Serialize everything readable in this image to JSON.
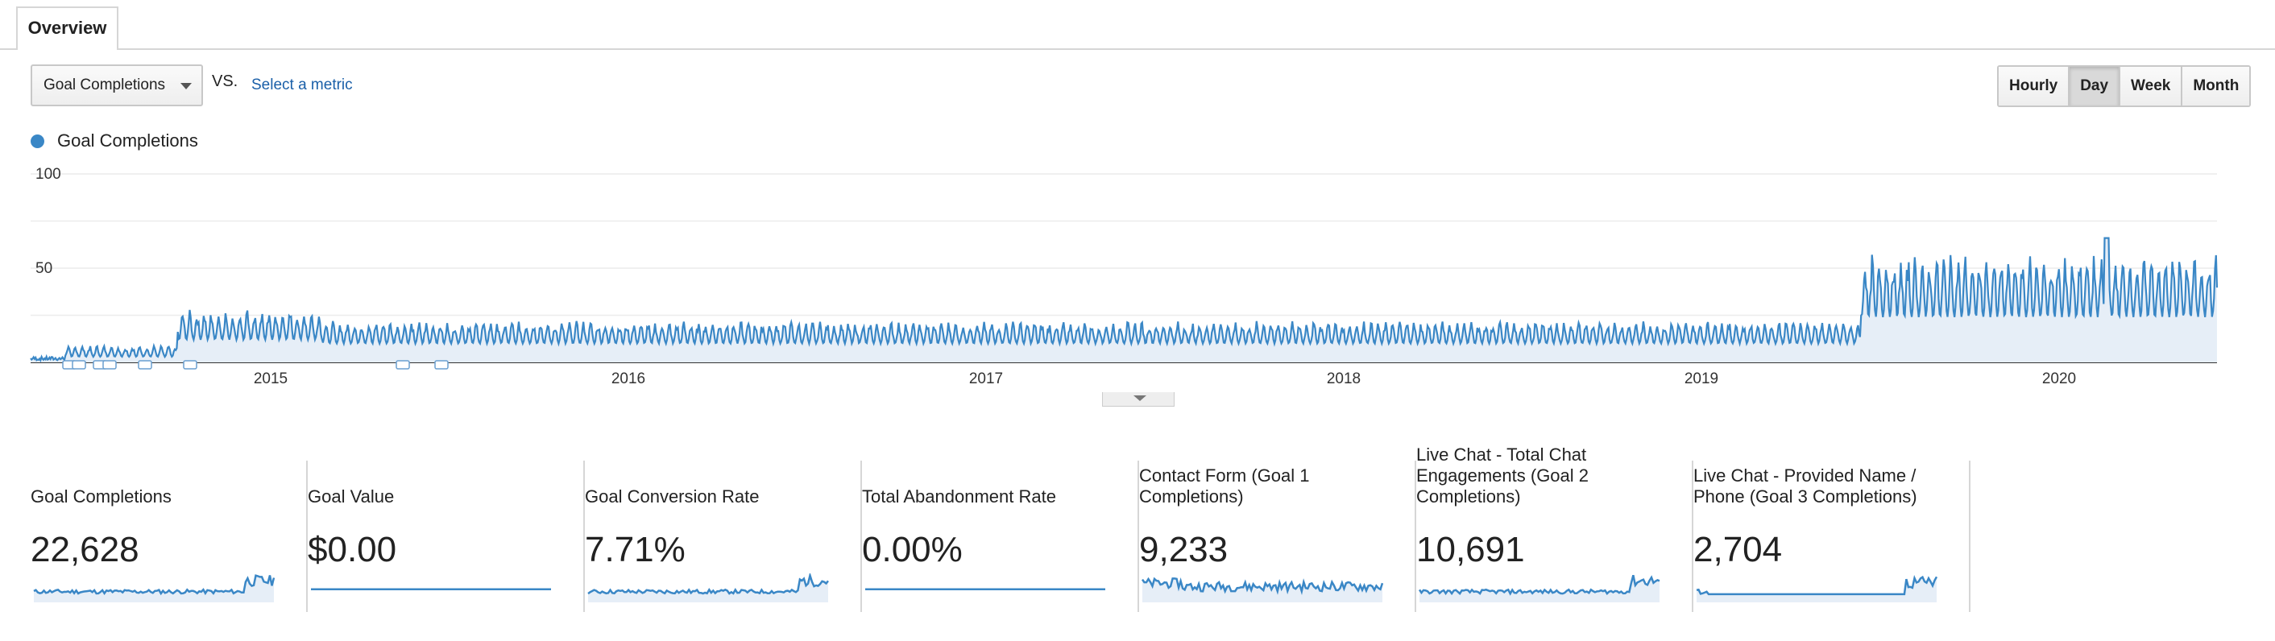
{
  "tabs": {
    "overview": "Overview"
  },
  "metric_selector": {
    "value": "Goal Completions",
    "vs": "VS.",
    "select_metric": "Select a metric"
  },
  "periods": [
    {
      "label": "Hourly",
      "active": false
    },
    {
      "label": "Day",
      "active": true
    },
    {
      "label": "Week",
      "active": false
    },
    {
      "label": "Month",
      "active": false
    }
  ],
  "legend": {
    "series": "Goal Completions",
    "color": "#3a87c6"
  },
  "chart_data": {
    "type": "area",
    "series": [
      {
        "name": "Goal Completions"
      }
    ],
    "y_ticks": [
      "100",
      "50"
    ],
    "ylim": [
      0,
      100
    ],
    "x_labels": [
      "2015",
      "2016",
      "2017",
      "2018",
      "2019",
      "2020"
    ],
    "segments": [
      {
        "start": "2014-06",
        "end": "2014-12",
        "base": 5,
        "amp": 7
      },
      {
        "start": "2015-01",
        "end": "2015-06",
        "base": 14,
        "amp": 16
      },
      {
        "start": "2015-06",
        "end": "2019-06",
        "base": 12,
        "amp": 12
      },
      {
        "start": "2019-06",
        "end": "2020-05",
        "base": 30,
        "amp": 30
      }
    ],
    "peak": {
      "date": "2020-02",
      "value": 66
    },
    "grid": true
  },
  "cards": [
    {
      "label": "Goal Completions",
      "value": "22,628",
      "spark": "step"
    },
    {
      "label": "Goal Value",
      "value": "$0.00",
      "spark": "flat"
    },
    {
      "label": "Goal Conversion Rate",
      "value": "7.71%",
      "spark": "step"
    },
    {
      "label": "Total Abandonment Rate",
      "value": "0.00%",
      "spark": "flat"
    },
    {
      "label": "Contact Form (Goal 1 Completions)",
      "value": "9,233",
      "spark": "noisy"
    },
    {
      "label": "Live Chat - Total Chat Engagements (Goal 2 Completions)",
      "value": "10,691",
      "spark": "step"
    },
    {
      "label": "Live Chat - Provided Name / Phone (Goal 3 Completions)",
      "value": "2,704",
      "spark": "late"
    }
  ]
}
